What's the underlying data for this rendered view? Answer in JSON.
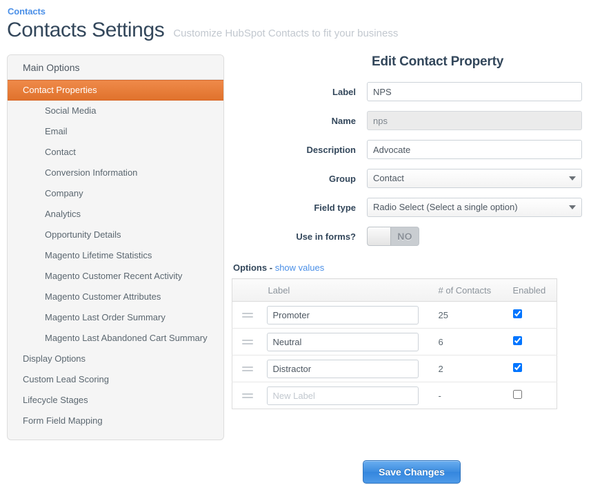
{
  "header": {
    "breadcrumb": "Contacts",
    "title": "Contacts Settings",
    "subtitle": "Customize HubSpot Contacts to fit your business"
  },
  "sidebar": {
    "header": "Main Options",
    "items": [
      {
        "label": "Contact Properties",
        "level": 0,
        "active": true
      },
      {
        "label": "Social Media",
        "level": 1,
        "active": false
      },
      {
        "label": "Email",
        "level": 1,
        "active": false
      },
      {
        "label": "Contact",
        "level": 1,
        "active": false
      },
      {
        "label": "Conversion Information",
        "level": 1,
        "active": false
      },
      {
        "label": "Company",
        "level": 1,
        "active": false
      },
      {
        "label": "Analytics",
        "level": 1,
        "active": false
      },
      {
        "label": "Opportunity Details",
        "level": 1,
        "active": false
      },
      {
        "label": "Magento Lifetime Statistics",
        "level": 1,
        "active": false
      },
      {
        "label": "Magento Customer Recent Activity",
        "level": 1,
        "active": false
      },
      {
        "label": "Magento Customer Attributes",
        "level": 1,
        "active": false
      },
      {
        "label": "Magento Last Order Summary",
        "level": 1,
        "active": false
      },
      {
        "label": "Magento Last Abandoned Cart Summary",
        "level": 1,
        "active": false
      },
      {
        "label": "Display Options",
        "level": 0,
        "active": false
      },
      {
        "label": "Custom Lead Scoring",
        "level": 0,
        "active": false
      },
      {
        "label": "Lifecycle Stages",
        "level": 0,
        "active": false
      },
      {
        "label": "Form Field Mapping",
        "level": 0,
        "active": false
      }
    ]
  },
  "form": {
    "title": "Edit Contact Property",
    "fields": {
      "label": {
        "label": "Label",
        "value": "NPS",
        "placeholder": ""
      },
      "name": {
        "label": "Name",
        "value": "nps",
        "disabled": true
      },
      "description": {
        "label": "Description",
        "value": "Advocate",
        "placeholder": ""
      },
      "group": {
        "label": "Group",
        "value": "Contact"
      },
      "field_type": {
        "label": "Field type",
        "value": "Radio Select (Select a single option)"
      },
      "use_in_forms": {
        "label": "Use in forms?",
        "state": "NO",
        "on": false
      }
    }
  },
  "options": {
    "heading": "Options",
    "separator": "-",
    "show_values_link": "show values",
    "columns": {
      "handle": "",
      "label": "Label",
      "count": "# of Contacts",
      "enabled": "Enabled"
    },
    "rows": [
      {
        "label": "Promoter",
        "placeholder": "",
        "count": "25",
        "enabled": true,
        "is_new": false
      },
      {
        "label": "Neutral",
        "placeholder": "",
        "count": "6",
        "enabled": true,
        "is_new": false
      },
      {
        "label": "Distractor",
        "placeholder": "",
        "count": "2",
        "enabled": true,
        "is_new": false
      },
      {
        "label": "",
        "placeholder": "New Label",
        "count": "-",
        "enabled": false,
        "is_new": true
      }
    ]
  },
  "footer": {
    "save_label": "Save Changes"
  },
  "colors": {
    "accent_orange": "#e0722c",
    "link_blue": "#4a8fe7",
    "button_blue": "#3c8ce0",
    "text": "#33475b"
  }
}
